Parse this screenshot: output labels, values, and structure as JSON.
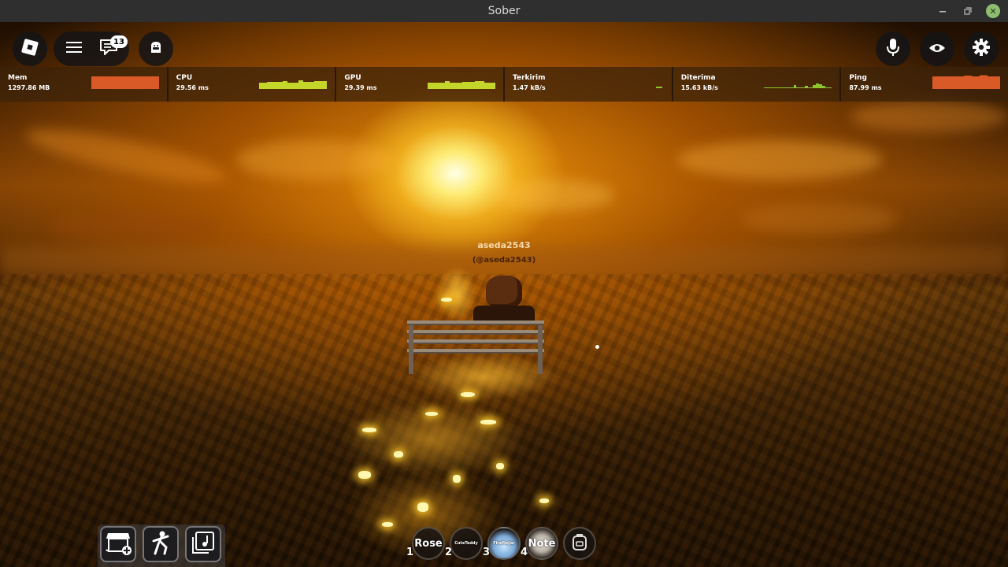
{
  "window": {
    "title": "Sober",
    "controls": [
      "minimize-icon",
      "maximize-icon",
      "close-icon"
    ]
  },
  "topbar": {
    "left_buttons": [
      "roblox-logo-icon",
      "hamburger-menu-icon",
      "chat-icon",
      "backpack-avatar-icon"
    ],
    "chat_badge": "13",
    "right_buttons": [
      "microphone-icon",
      "eye-icon",
      "gear-icon"
    ]
  },
  "stats": [
    {
      "label": "Mem",
      "value": "1297.86 MB",
      "color": "#d95a26",
      "type": "block"
    },
    {
      "label": "CPU",
      "value": "29.56 ms",
      "color": "#c5d62b",
      "type": "block"
    },
    {
      "label": "GPU",
      "value": "29.39 ms",
      "color": "#c5d62b",
      "type": "block"
    },
    {
      "label": "Terkirim",
      "value": "1.47 kB/s",
      "color": "#8fc62b",
      "type": "tiny"
    },
    {
      "label": "Diterima",
      "value": "15.63 kB/s",
      "color": "#8fc62b",
      "type": "spiky"
    },
    {
      "label": "Ping",
      "value": "87.99 ms",
      "color": "#d95a26",
      "type": "block"
    }
  ],
  "player": {
    "name": "aseda2543",
    "handle": "(@aseda2543)"
  },
  "bottom_left": [
    "shop-add-icon",
    "emote-dance-icon",
    "music-note-icon"
  ],
  "hotbar": [
    {
      "num": "1",
      "label": "Rose",
      "small": false
    },
    {
      "num": "2",
      "label": "CuteTeddy",
      "small": true
    },
    {
      "num": "3",
      "label": "FireflieJar",
      "small": true
    },
    {
      "num": "4",
      "label": "Note",
      "small": false
    }
  ],
  "backpack_icon": "backpack-icon"
}
